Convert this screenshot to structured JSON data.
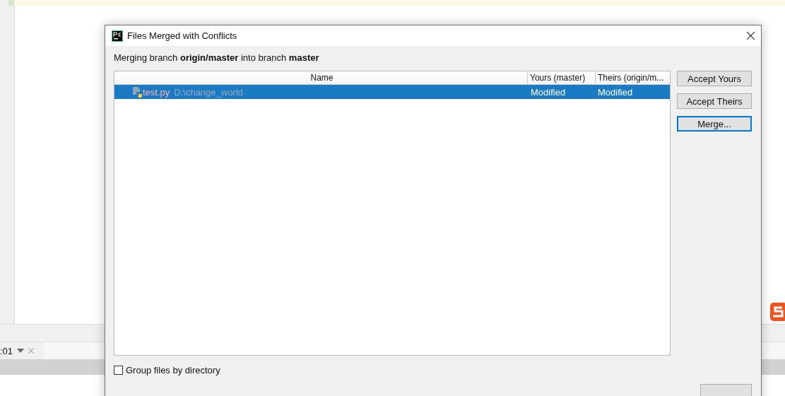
{
  "editor_tab": {
    "label": ":01"
  },
  "dialog": {
    "title": "Files Merged with Conflicts",
    "subtitle": "Merging branch **origin/master** into branch **master**",
    "table": {
      "columns": [
        "Name",
        "Yours (master)",
        "Theirs (origin/m..."
      ],
      "rows": [
        {
          "file": "test.py",
          "path": "D:\\change_world",
          "yours": "Modified",
          "theirs": "Modified",
          "selected": true
        }
      ]
    },
    "buttons": [
      {
        "label": "Accept Yours",
        "focused": false
      },
      {
        "label": "Accept Theirs",
        "focused": false
      },
      {
        "label": "Merge...",
        "focused": true
      }
    ],
    "group_by_directory": {
      "label": "Group files by directory",
      "checked": false
    }
  }
}
